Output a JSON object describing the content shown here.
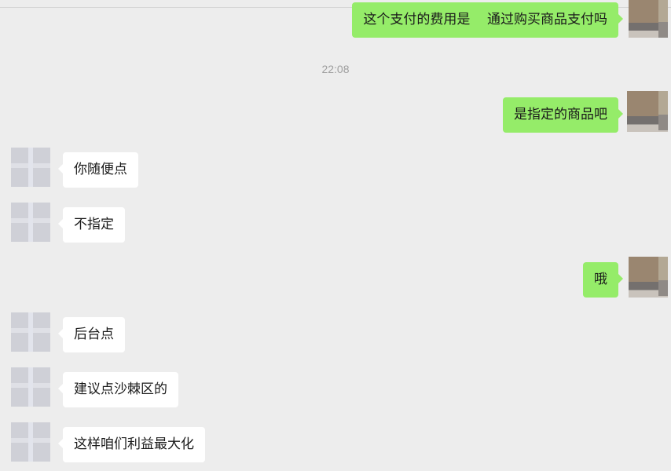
{
  "timestamp": "22:08",
  "messages": [
    {
      "sender": "me",
      "text": "这个支付的费用是    通过购买商品支付吗"
    },
    {
      "sender": "me",
      "text": "是指定的商品吧"
    },
    {
      "sender": "them",
      "text": "你随便点"
    },
    {
      "sender": "them",
      "text": "不指定"
    },
    {
      "sender": "me",
      "text": "哦"
    },
    {
      "sender": "them",
      "text": "后台点"
    },
    {
      "sender": "them",
      "text": "建议点沙棘区的"
    },
    {
      "sender": "them",
      "text": "这样咱们利益最大化"
    }
  ]
}
